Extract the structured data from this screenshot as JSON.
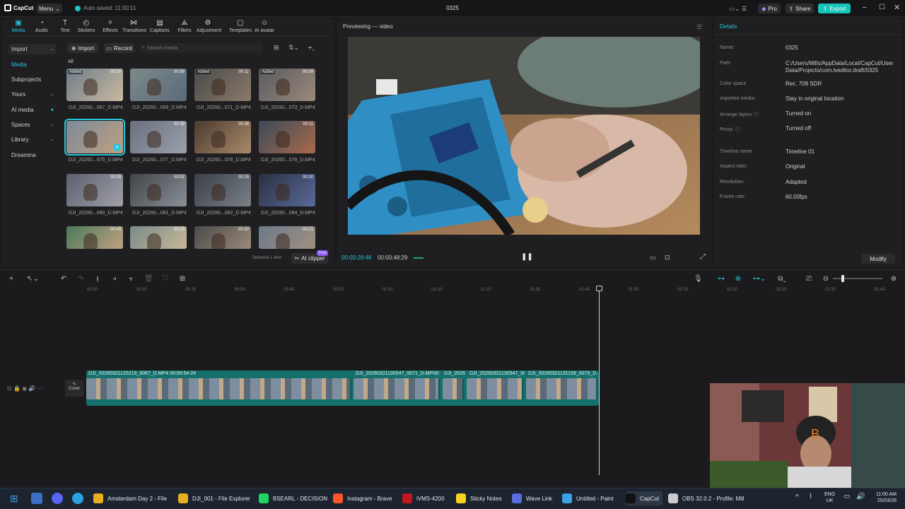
{
  "app": {
    "logo_text": "CapCut",
    "menu_label": "Menu",
    "autosave_text": "Auto saved: 11:00:11",
    "project_title": "0325",
    "pro_label": "Pro",
    "share_label": "Share",
    "export_label": "Export"
  },
  "toolbar": [
    {
      "label": "Media",
      "icon": "media-icon"
    },
    {
      "label": "Audio",
      "icon": "audio-icon"
    },
    {
      "label": "Text",
      "icon": "text-icon"
    },
    {
      "label": "Stickers",
      "icon": "stickers-icon"
    },
    {
      "label": "Effects",
      "icon": "effects-icon"
    },
    {
      "label": "Transitions",
      "icon": "transitions-icon"
    },
    {
      "label": "Captions",
      "icon": "captions-icon"
    },
    {
      "label": "Filters",
      "icon": "filters-icon"
    },
    {
      "label": "Adjustment",
      "icon": "adjustment-icon"
    },
    {
      "label": "Templates",
      "icon": "templates-icon"
    },
    {
      "label": "AI avatar",
      "icon": "ai-avatar-icon"
    }
  ],
  "sidebar": [
    {
      "label": "Import",
      "chevron": true
    },
    {
      "label": "Media",
      "chevron": false
    },
    {
      "label": "Subprojects",
      "chevron": false
    },
    {
      "label": "Yours",
      "chevron": true
    },
    {
      "label": "AI media",
      "chevron": true
    },
    {
      "label": "Spaces",
      "chevron": true
    },
    {
      "label": "Library",
      "chevron": true
    },
    {
      "label": "Dreamina",
      "chevron": false
    }
  ],
  "media": {
    "import_label": "Import",
    "record_label": "Record",
    "search_placeholder": "Search media",
    "filter_label": "All",
    "selected_text": "Selected 1 item",
    "ai_clipper_label": "AI clipper",
    "free_badge": "Free",
    "items": [
      {
        "name": "DJI_20260...067_D.MP4",
        "duration": "00:33",
        "added": "Added"
      },
      {
        "name": "DJI_20260...069_D.MP4",
        "duration": "00:56",
        "added": ""
      },
      {
        "name": "DJI_20260...071_D.MP4",
        "duration": "00:11",
        "added": "Added"
      },
      {
        "name": "DJI_20260...073_D.MP4",
        "duration": "00:09",
        "added": "Added"
      },
      {
        "name": "DJI_20260...075_D.MP4",
        "duration": "",
        "added": ""
      },
      {
        "name": "DJI_20260...077_D.MP4",
        "duration": "00:39",
        "added": ""
      },
      {
        "name": "DJI_20260...078_D.MP4",
        "duration": "00:38",
        "added": ""
      },
      {
        "name": "DJI_20260...079_D.MP4",
        "duration": "00:11",
        "added": ""
      },
      {
        "name": "DJI_20260...080_D.MP4",
        "duration": "00:33",
        "added": ""
      },
      {
        "name": "DJI_20260...081_D.MP4",
        "duration": "00:02",
        "added": ""
      },
      {
        "name": "DJI_20260...082_D.MP4",
        "duration": "00:15",
        "added": ""
      },
      {
        "name": "DJI_20260...084_D.MP4",
        "duration": "00:20",
        "added": ""
      },
      {
        "name": "",
        "duration": "00:43",
        "added": ""
      },
      {
        "name": "",
        "duration": "00:23",
        "added": ""
      },
      {
        "name": "",
        "duration": "00:30",
        "added": ""
      },
      {
        "name": "",
        "duration": "00:21",
        "added": ""
      }
    ]
  },
  "player": {
    "title": "Previewing — video",
    "current_time": "00:00:28:48",
    "total_time": "00:00:48:29"
  },
  "details": {
    "header": "Details",
    "rows": [
      {
        "label": "Name:",
        "value": "0325"
      },
      {
        "label": "Path:",
        "value": "C:/Users/Mills/AppData/Local/CapCut/User Data/Projects/com.lveditor.draft/0325"
      },
      {
        "label": "Color space",
        "value": "Rec. 709 SDR"
      },
      {
        "label": "Imported media:",
        "value": "Stay in original location"
      },
      {
        "label": "Arrange layers ⓘ",
        "value": "Turned on"
      },
      {
        "label": "Proxy: ⓘ",
        "value": "Turned off"
      },
      {
        "label": "Timeline name",
        "value": "Timeline 01"
      },
      {
        "label": "Aspect ratio:",
        "value": "Original"
      },
      {
        "label": "Resolution:",
        "value": "Adapted"
      },
      {
        "label": "Frame rate:",
        "value": "60.00fps"
      }
    ],
    "modify_label": "Modify"
  },
  "timeline": {
    "ruler": [
      "00:00",
      "00:10",
      "00:20",
      "00:30",
      "00:40",
      "00:50",
      "01:00",
      "01:10",
      "01:20",
      "01:30",
      "01:40",
      "01:50",
      "02:00",
      "02:10",
      "02:20",
      "02:30",
      "02:40"
    ],
    "cover_label": "Cover",
    "clips": [
      {
        "label": "DJI_20260321120219_0067_D.MP4   00:00:54:24"
      },
      {
        "label": "DJI_20260321130547_0071_D.MP4"
      },
      {
        "label": "00"
      },
      {
        "label": "DJI_2026"
      },
      {
        "label": "DJI_20260321130547_007"
      },
      {
        "label": "DJI_20260321131159_0073_D.MP"
      }
    ]
  },
  "taskbar": {
    "items": [
      {
        "label": "Amsterdam Day 2 - File",
        "color": "#e8b020"
      },
      {
        "label": "DJI_001 - File Explorer",
        "color": "#e8b020"
      },
      {
        "label": "BSEARL - DECISION",
        "color": "#1ed760"
      },
      {
        "label": "Instagram - Brave",
        "color": "#fb542b"
      },
      {
        "label": "iVMS-4200",
        "color": "#c4161c"
      },
      {
        "label": "Sticky Notes",
        "color": "#f7d31e"
      },
      {
        "label": "Wave Link",
        "color": "#5b6ee1"
      },
      {
        "label": "Untitled - Paint",
        "color": "#3aa0e8"
      },
      {
        "label": "CapCut",
        "color": "#ffffff"
      },
      {
        "label": "OBS 32.0.2 - Profile: Mill",
        "color": "#cccccc"
      }
    ],
    "lang_top": "ENG",
    "lang_bottom": "UK",
    "time": "11:00 AM",
    "date": "25/03/26"
  },
  "colors": {
    "accent": "#22c6d8",
    "export": "#16c4b8",
    "clip": "#14706a"
  }
}
